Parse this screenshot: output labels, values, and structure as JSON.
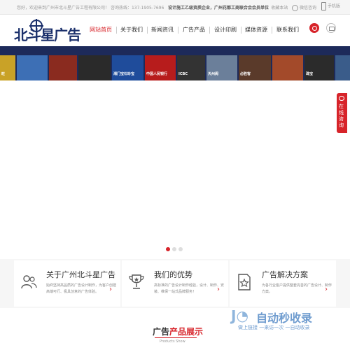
{
  "topbar": {
    "welcome": "您好，欢迎来到广州市北斗星广告工程有限公司！",
    "hotline_label": "咨询热线：",
    "hotline": "137-1905-7696",
    "qualification": "设计施工乙级资质企业，广州花都工商联合会会员单位",
    "favorite": "收藏本站",
    "wechat": "微信咨询",
    "mobile": "手机版"
  },
  "logo": {
    "text": "北斗星广告"
  },
  "nav": {
    "items": [
      "网站首页",
      "关于我们",
      "新闻资讯",
      "广告产品",
      "设计印刷",
      "媒体资源",
      "联系我们"
    ]
  },
  "banner": {
    "signs": [
      "旺",
      "ICBC",
      "中国人民银行",
      "湘门宝石珍宝",
      "天州阁",
      "必胜客",
      "中国工商银行",
      "珠宝"
    ]
  },
  "consult": {
    "label": "在线咨询"
  },
  "features": [
    {
      "title": "关于广州北斗星广告",
      "desc": "始终坚持高品质的广告设计制作，为客户创建高端可行、极具创意的广告体验。",
      "icon": "people-icon"
    },
    {
      "title": "我们的优势",
      "desc": "高标准的广告设计制作经验，设计、制作、安装、维保一站式品牌服务！",
      "icon": "trophy-icon"
    },
    {
      "title": "广告解决方案",
      "desc": "为各行业客户提供整套完善的广告设计、制作方案。",
      "icon": "star-document-icon"
    }
  ],
  "products": {
    "title_a": "广告",
    "title_b": "产品展示",
    "subtitle": "Products Show"
  },
  "watermark": {
    "name": "自动秒收录",
    "tagline": "做上链接 一来访一次 一自动收录"
  },
  "colors": {
    "brand_red": "#d7242a",
    "logo_blue": "#1a2f6b",
    "banner_dark": "#1d2a5a"
  }
}
